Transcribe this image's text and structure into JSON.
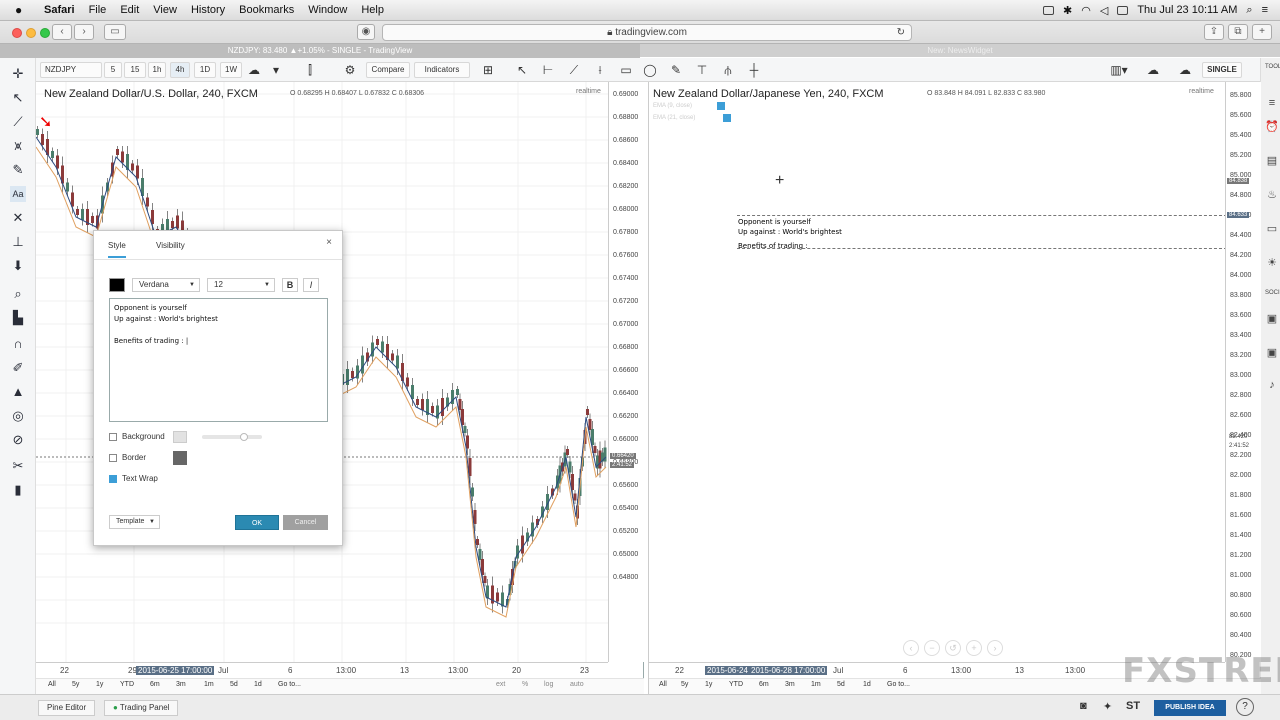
{
  "menubar": {
    "apple": "",
    "items": [
      "Safari",
      "File",
      "Edit",
      "View",
      "History",
      "Bookmarks",
      "Window",
      "Help"
    ],
    "clock": "Thu Jul 23  10:11 AM"
  },
  "browser": {
    "url": "tradingview.com",
    "tab_left": "NZDJPY: 83.480 ▲+1.05% - SINGLE - TradingView",
    "tab_right": "New: NewsWidget"
  },
  "toolbar": {
    "symbol": "NZDJPY",
    "intervals": [
      "5",
      "15",
      "1h",
      "4h",
      "1D",
      "1W"
    ],
    "compare": "Compare",
    "indicators": "Indicators",
    "layout": "SINGLE"
  },
  "left_chart": {
    "title": "New Zealand Dollar/U.S. Dollar, 240, FXCM",
    "ohlc": "O 0.68295  H 0.68407  L 0.67832  C 0.68306",
    "realtime": "realtime",
    "prices": [
      "0.69000",
      "0.68800",
      "0.68600",
      "0.68400",
      "0.68200",
      "0.68000",
      "0.67800",
      "0.67600",
      "0.67400",
      "0.67200",
      "0.67000",
      "0.66800",
      "0.66600",
      "0.66400",
      "0.66200",
      "0.66000",
      "0.65800",
      "0.65600",
      "0.65400",
      "0.65200",
      "0.65000",
      "0.64800"
    ],
    "price_tag_1": "0.66420",
    "price_tag_2": "2:41:52",
    "times": [
      "22",
      "29",
      "2015-06-25 17:00:00",
      "Jul",
      "6",
      "13:00",
      "13",
      "13:00",
      "20",
      "23"
    ],
    "ranges": [
      "All",
      "5y",
      "1y",
      "YTD",
      "6m",
      "3m",
      "1m",
      "5d",
      "1d",
      "Go to..."
    ],
    "scale_buttons": [
      "ext",
      "%",
      "log",
      "auto"
    ]
  },
  "right_chart": {
    "title": "New Zealand Dollar/Japanese Yen, 240, FXCM",
    "ohlc": "O 83.848  H 84.091  L 82.833  C 83.980",
    "realtime": "realtime",
    "indicators": [
      "EMA (9, close)",
      "EMA (21, close)"
    ],
    "prices": [
      "85.800",
      "85.600",
      "85.400",
      "85.200",
      "85.000",
      "84.800",
      "84.600",
      "84.400",
      "84.200",
      "84.000",
      "83.800",
      "83.600",
      "83.400",
      "83.200",
      "83.000",
      "82.800",
      "82.600",
      "82.400",
      "82.200",
      "82.000",
      "81.800",
      "81.600",
      "81.400",
      "81.200",
      "81.000",
      "80.800",
      "80.600",
      "80.400",
      "80.200"
    ],
    "price_tag_1": "84.838",
    "price_tag_2": "84.633",
    "price_tag_3": "82.420",
    "price_tag_4": "2:41:52",
    "times": [
      "22",
      "2015-06-24 1",
      "2015-06-28 17:00:00",
      "Jul",
      "6",
      "13:00",
      "13",
      "13:00"
    ],
    "ranges": [
      "All",
      "5y",
      "1y",
      "YTD",
      "6m",
      "3m",
      "1m",
      "5d",
      "1d",
      "Go to..."
    ],
    "note_lines": [
      "Opponent is yourself",
      "Up against : World's brightest",
      "",
      "Benefits of trading :"
    ]
  },
  "dialog": {
    "tab_style": "Style",
    "tab_visibility": "Visibility",
    "close": "×",
    "font": "Verdana",
    "size": "12",
    "bold": "B",
    "italic": "I",
    "text_lines": [
      "Opponent is yourself",
      "Up against : World's brightest",
      "",
      "Benefits of trading : |"
    ],
    "background": "Background",
    "border": "Border",
    "text_wrap": "Text Wrap",
    "text_wrap_checked": true,
    "template": "Template",
    "ok": "OK",
    "cancel": "Cancel"
  },
  "bottom": {
    "pine_editor": "Pine Editor",
    "trading_panel": "Trading Panel",
    "publish": "PUBLISH IDEA",
    "st": "ST"
  },
  "watermark": "FXSTREET",
  "colors": {
    "accent": "#3c9ed7",
    "ok_button": "#2b8ab2",
    "candle_up": "#4a7d6b",
    "candle_down": "#8b3a3a",
    "ema_fast": "#2b4a80",
    "ema_slow": "#e0a060"
  }
}
